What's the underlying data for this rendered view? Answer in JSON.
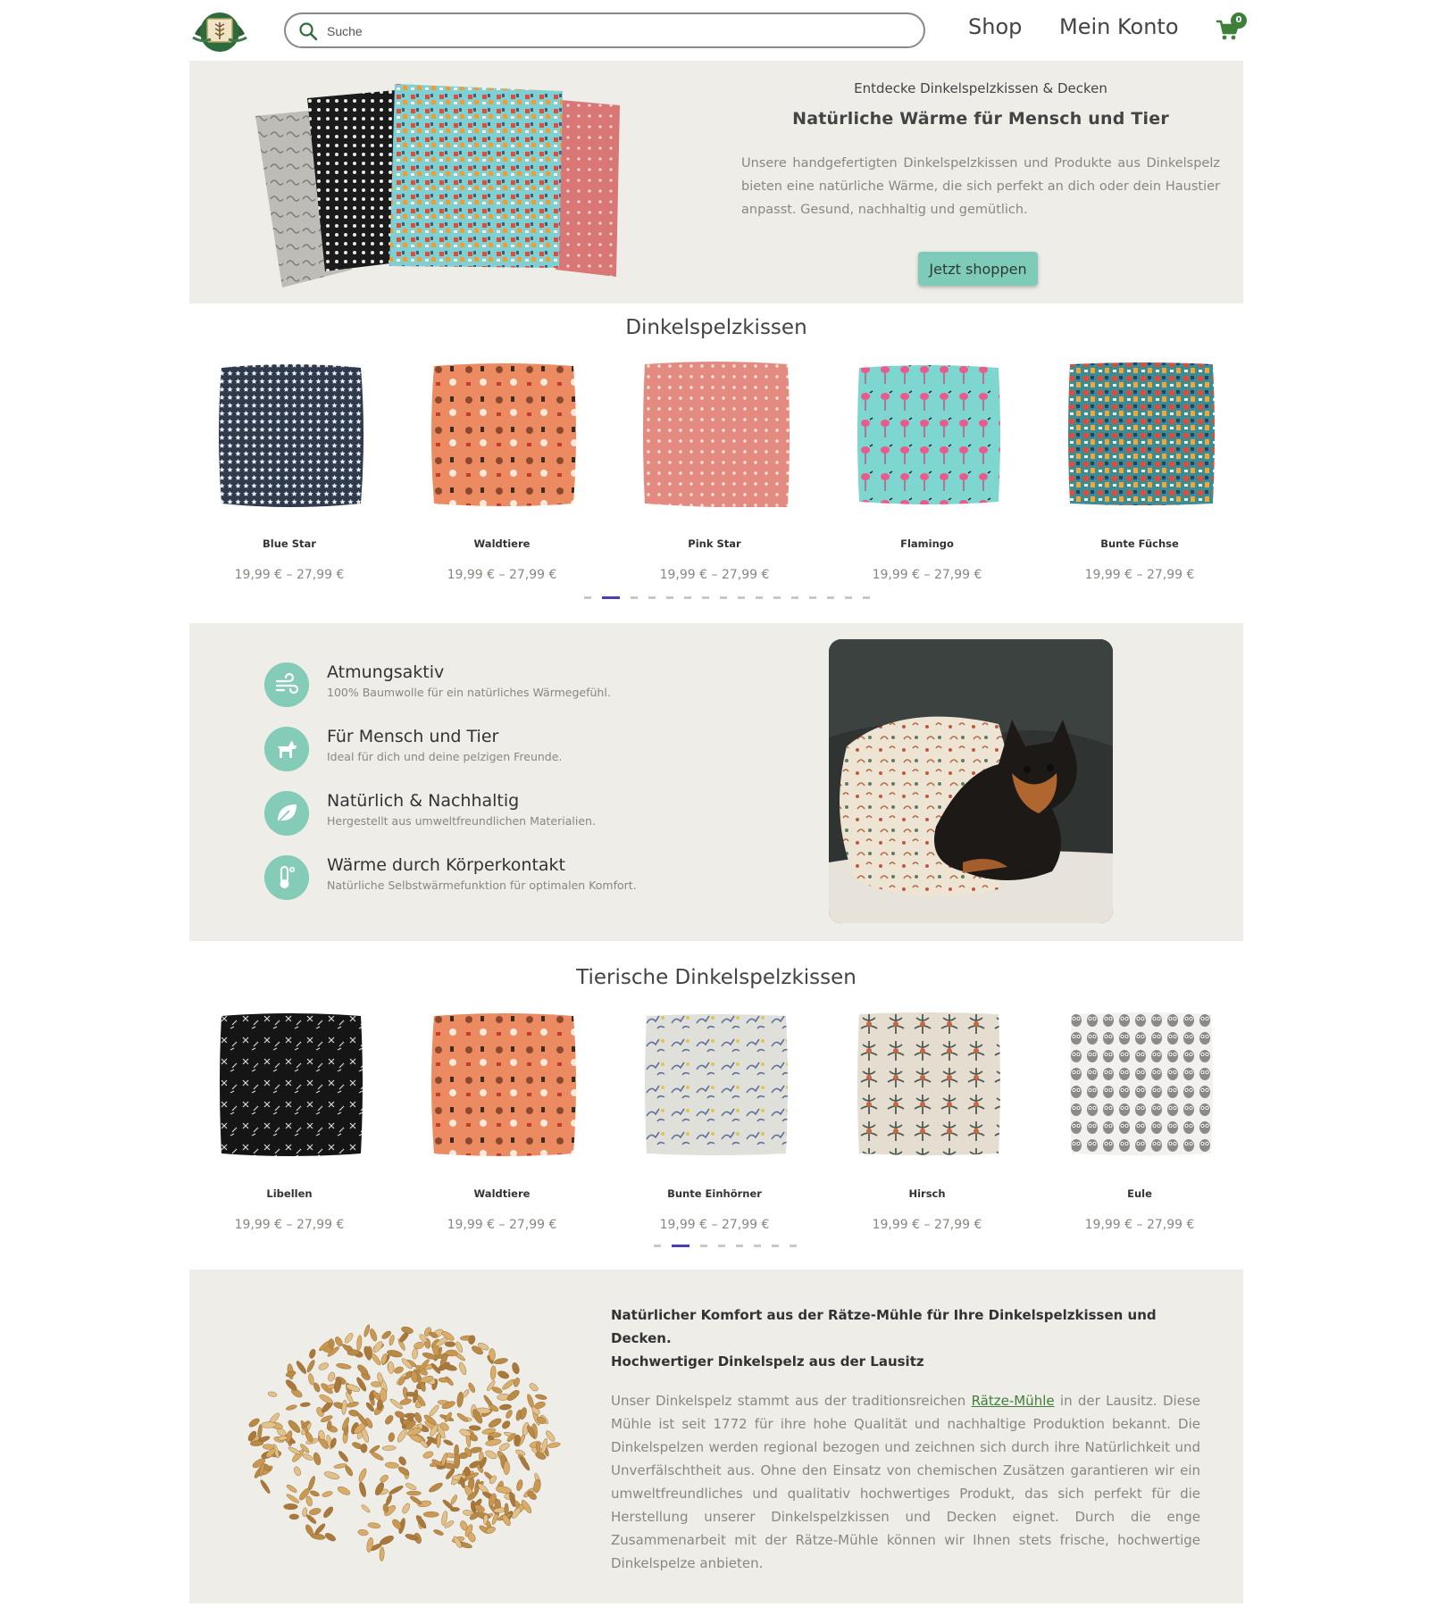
{
  "header": {
    "search_placeholder": "Suche",
    "nav": [
      "Shop",
      "Mein Konto"
    ],
    "cart_count": "0"
  },
  "hero": {
    "kicker": "Entdecke Dinkelspelzkissen & Decken",
    "title": "Natürliche Wärme für Mensch und Tier",
    "description": "Unsere handgefertigten Dinkelspelzkissen und Produkte aus Dinkelspelz bieten eine natürliche Wärme, die sich perfekt an dich oder dein Haustier anpasst. Gesund, nachhaltig und gemütlich.",
    "cta": "Jetzt shoppen"
  },
  "section1": {
    "title": "Dinkelspelzkissen",
    "products": [
      {
        "name": "Blue Star",
        "price": "19,99 € – 27,99 €"
      },
      {
        "name": "Waldtiere",
        "price": "19,99 € – 27,99 €"
      },
      {
        "name": "Pink Star",
        "price": "19,99 € – 27,99 €"
      },
      {
        "name": "Flamingo",
        "price": "19,99 € – 27,99 €"
      },
      {
        "name": "Bunte Füchse",
        "price": "19,99 € – 27,99 €"
      }
    ],
    "dots_total": 16,
    "dots_active": 2
  },
  "features": [
    {
      "title": "Atmungsaktiv",
      "desc": "100% Baumwolle für ein natürliches Wärmegefühl.",
      "icon": "wind-icon"
    },
    {
      "title": "Für Mensch und Tier",
      "desc": "Ideal für dich und deine pelzigen Freunde.",
      "icon": "dog-icon"
    },
    {
      "title": "Natürlich & Nachhaltig",
      "desc": "Hergestellt aus umweltfreundlichen Materialien.",
      "icon": "leaf-icon"
    },
    {
      "title": "Wärme durch Körperkontakt",
      "desc": "Natürliche Selbstwärmefunktion für optimalen Komfort.",
      "icon": "thermometer-icon"
    }
  ],
  "section2": {
    "title": "Tierische Dinkelspelzkissen",
    "products": [
      {
        "name": "Libellen",
        "price": "19,99 € – 27,99 €"
      },
      {
        "name": "Waldtiere",
        "price": "19,99 € – 27,99 €"
      },
      {
        "name": "Bunte Einhörner",
        "price": "19,99 € – 27,99 €"
      },
      {
        "name": "Hirsch",
        "price": "19,99 € – 27,99 €"
      },
      {
        "name": "Eule",
        "price": "19,99 € – 27,99 €"
      }
    ],
    "dots_total": 8,
    "dots_active": 2
  },
  "about": {
    "heading_1": "Natürlicher Komfort aus der Rätze-Mühle für Ihre Dinkelspelzkissen und Decken.",
    "heading_2": "Hochwertiger Dinkelspelz aus der Lausitz",
    "body_before": "Unser Dinkelspelz stammt aus der traditionsreichen ",
    "link": "Rätze-Mühle",
    "body_after": " in der Lausitz. Diese Mühle ist seit 1772 für ihre hohe Qualität und nachhaltige Produktion bekannt. Die Dinkelspelzen werden regional bezogen und zeichnen sich durch ihre Natürlichkeit und Unverfälschtheit aus. Ohne den Einsatz von chemischen Zusätzen garantieren wir ein umweltfreundliches und qualitativ hochwertiges Produkt, das sich perfekt für die Herstellung unserer Dinkelspelzkissen und Decken eignet. Durch die enge Zusammenarbeit mit der Rätze-Mühle können wir Ihnen stets frische, hochwertige Dinkelspelze anbieten."
  },
  "colors": {
    "accent": "#84cbb8",
    "brand_green": "#3f7f3a",
    "band": "#efede8",
    "dot_active": "#4a3fb8"
  }
}
